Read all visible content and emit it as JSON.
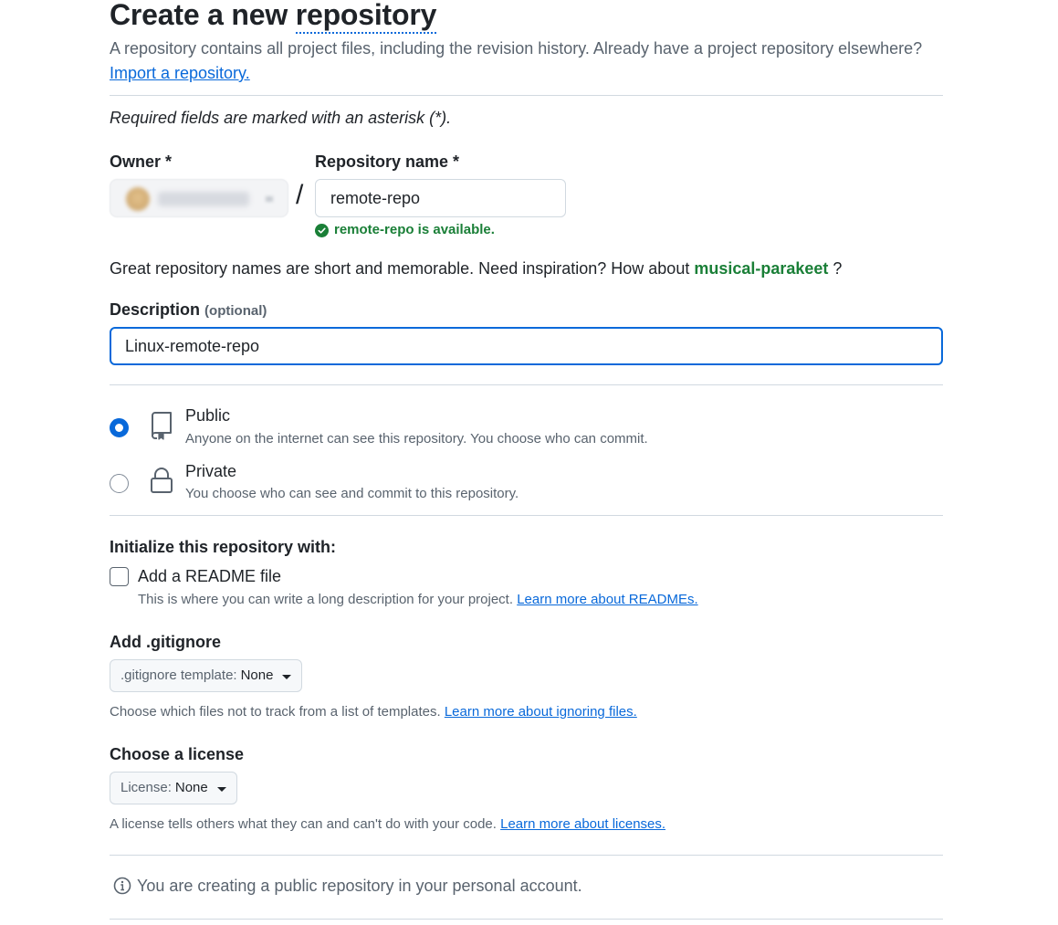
{
  "header": {
    "title_part1": "Create a new ",
    "title_part2": "repository",
    "subtitle": "A repository contains all project files, including the revision history. Already have a project repository elsewhere?",
    "import_link": "Import a repository."
  },
  "form": {
    "required_note": "Required fields are marked with an asterisk (*).",
    "owner_label": "Owner *",
    "slash": "/",
    "repo_name_label": "Repository name *",
    "repo_name_value": "remote-repo",
    "availability": "remote-repo is available.",
    "inspiration_prefix": "Great repository names are short and memorable. Need inspiration? How about ",
    "inspiration_suggestion": "musical-parakeet",
    "inspiration_suffix": " ?",
    "description_label": "Description",
    "description_optional": "(optional)",
    "description_value": "Linux-remote-repo"
  },
  "visibility": {
    "public_title": "Public",
    "public_desc": "Anyone on the internet can see this repository. You choose who can commit.",
    "private_title": "Private",
    "private_desc": "You choose who can see and commit to this repository.",
    "selected": "Public"
  },
  "init": {
    "heading": "Initialize this repository with:",
    "readme_label": "Add a README file",
    "readme_checked": false,
    "readme_help": "This is where you can write a long description for your project. ",
    "readme_link": "Learn more about READMEs."
  },
  "gitignore": {
    "heading": "Add .gitignore",
    "select_prefix": ".gitignore template:",
    "select_value": "None",
    "help": "Choose which files not to track from a list of templates. ",
    "link": "Learn more about ignoring files."
  },
  "license": {
    "heading": "Choose a license",
    "select_prefix": "License:",
    "select_value": "None",
    "help": "A license tells others what they can and can't do with your code. ",
    "link": "Learn more about licenses."
  },
  "notice": {
    "text": "You are creating a public repository in your personal account."
  },
  "colors": {
    "accent": "#0969da",
    "success": "#1a7f37",
    "muted": "#59636e",
    "border": "#d1d9e0"
  },
  "icons": {
    "visibility_public": "repo-icon",
    "visibility_private": "lock-icon",
    "availability": "check-circle-icon",
    "notice": "info-icon"
  }
}
